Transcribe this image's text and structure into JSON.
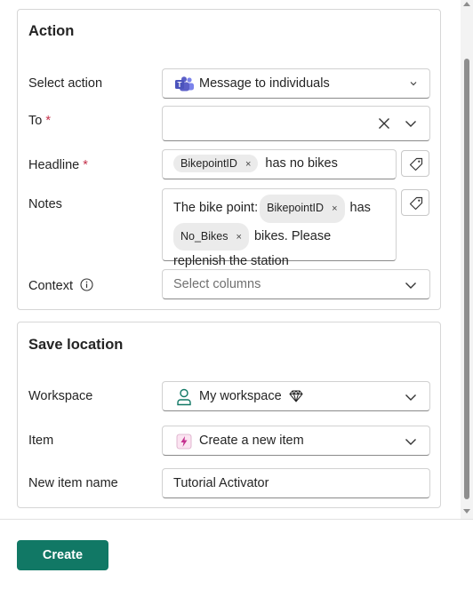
{
  "action_section": {
    "title": "Action",
    "select_action": {
      "label": "Select action",
      "value": "Message to individuals",
      "icon": "teams-icon"
    },
    "to": {
      "label": "To",
      "required_mark": "*",
      "value": ""
    },
    "headline": {
      "label": "Headline",
      "required_mark": "*",
      "chip": "BikepointID",
      "text_after": "has no bikes"
    },
    "notes": {
      "label": "Notes",
      "text_1": "The bike point:",
      "chip_1": "BikepointID",
      "text_2": "has",
      "chip_2": "No_Bikes",
      "text_3": "bikes. Please",
      "text_4": "replenish the station"
    },
    "context": {
      "label": "Context",
      "placeholder": "Select columns",
      "info_icon": "info-icon"
    }
  },
  "save_section": {
    "title": "Save location",
    "workspace": {
      "label": "Workspace",
      "value": "My workspace",
      "icon": "person-icon",
      "badge_icon": "diamond-icon"
    },
    "item": {
      "label": "Item",
      "value": "Create a new item",
      "icon": "activator-icon"
    },
    "new_item_name": {
      "label": "New item name",
      "value": "Tutorial Activator"
    }
  },
  "chip_remove_glyph": "×",
  "footer": {
    "create_label": "Create"
  },
  "colors": {
    "primary": "#117865",
    "required": "#c4314b",
    "chip_bg": "#ebebeb",
    "teams": "#5b5fc7",
    "workspace_icon": "#117865",
    "activator": "#c4318f"
  }
}
